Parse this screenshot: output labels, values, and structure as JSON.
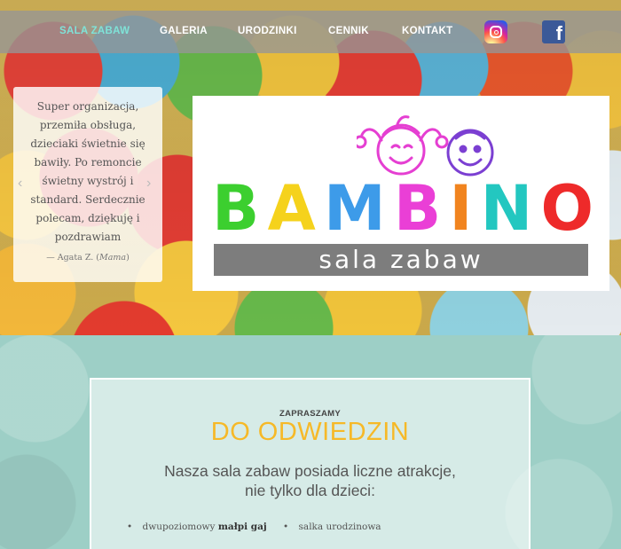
{
  "nav": {
    "items": [
      {
        "label": "SALA ZABAW",
        "active": true
      },
      {
        "label": "GALERIA",
        "active": false
      },
      {
        "label": "URODZINKI",
        "active": false
      },
      {
        "label": "CENNIK",
        "active": false
      },
      {
        "label": "KONTAKT",
        "active": false
      }
    ],
    "social": [
      {
        "icon": "instagram-icon"
      },
      {
        "icon": "facebook-icon"
      }
    ],
    "active_color": "#7fe3d8"
  },
  "testimonial": {
    "quote": "Super organizacja, przemiła obsługa, dzieciaki świetnie się bawiły. Po remoncie świetny wystrój i standard. Serdecznie polecam, dziękuję i pozdrawiam",
    "author_prefix": "— Agata Z.",
    "author_role": "Mama"
  },
  "logo": {
    "word_letters": [
      {
        "char": "B",
        "color": "#3ccf2f"
      },
      {
        "char": "A",
        "color": "#f5d21c"
      },
      {
        "char": "M",
        "color": "#3d9be9"
      },
      {
        "char": "B",
        "color": "#ea3fd6"
      },
      {
        "char": "I",
        "color": "#f1841f"
      },
      {
        "char": "N",
        "color": "#23c7c0"
      },
      {
        "char": "O",
        "color": "#ee2a2a"
      }
    ],
    "subtitle": "sala zabaw"
  },
  "intro": {
    "kicker": "ZAPRASZAMY",
    "headline": "DO ODWIEDZIN",
    "lead_line1": "Nasza sala zabaw posiada liczne atrakcje,",
    "lead_line2": "nie tylko dla dzieci:",
    "features": [
      {
        "text": "dwupoziomowy ",
        "bold": "małpi gaj"
      },
      {
        "text": "salka urodzinowa",
        "bold": ""
      }
    ],
    "headline_color": "#f6b928"
  }
}
